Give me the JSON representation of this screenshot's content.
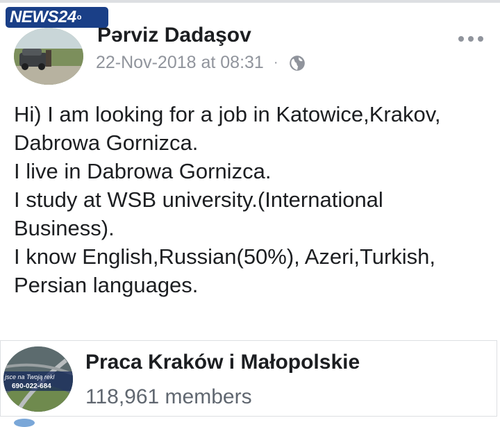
{
  "watermark": {
    "brand": "NEWS24",
    "suffix": "o"
  },
  "post": {
    "author": "Pərviz Dadaşov",
    "timestamp": "22-Nov-2018 at 08:31",
    "separator": "·",
    "privacy_icon": "globe-icon",
    "more_icon": "more-options-icon",
    "lines": [
      "Hi) I am looking for a job in Katowice,Krakov,",
      "Dabrowa Gornizca.",
      "I live in Dabrowa Gornizca.",
      "I study at WSB university.(International",
      "Business).",
      "I know English,Russian(50%), Azeri,Turkish,",
      "Persian languages."
    ]
  },
  "group": {
    "name": "Praca Kraków i Małopolskie",
    "members": "118,961 members",
    "avatar_text_1": "jsce na Twoją rekl",
    "avatar_text_2": "690-022-684"
  },
  "colors": {
    "watermark_bg": "#1a3f87",
    "meta_gray": "#90949c",
    "text": "#1c1e21"
  }
}
